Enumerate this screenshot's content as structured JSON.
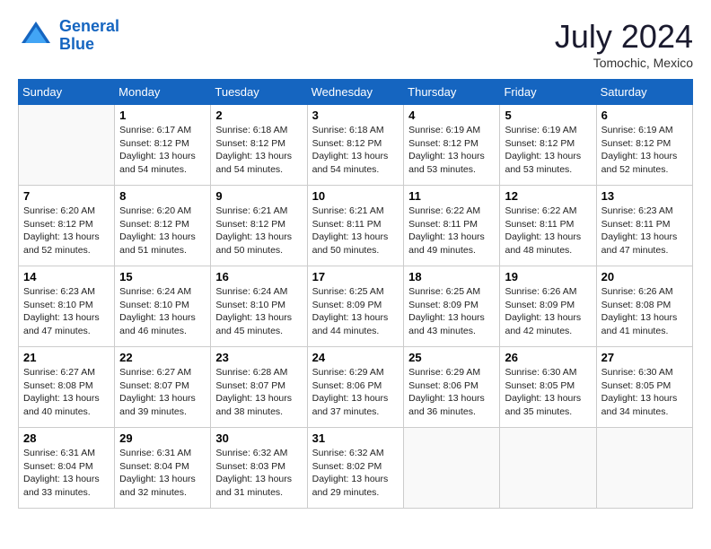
{
  "header": {
    "logo_line1": "General",
    "logo_line2": "Blue",
    "month": "July 2024",
    "location": "Tomochic, Mexico"
  },
  "weekdays": [
    "Sunday",
    "Monday",
    "Tuesday",
    "Wednesday",
    "Thursday",
    "Friday",
    "Saturday"
  ],
  "weeks": [
    [
      {
        "day": "",
        "sunrise": "",
        "sunset": "",
        "daylight": ""
      },
      {
        "day": "1",
        "sunrise": "Sunrise: 6:17 AM",
        "sunset": "Sunset: 8:12 PM",
        "daylight": "Daylight: 13 hours and 54 minutes."
      },
      {
        "day": "2",
        "sunrise": "Sunrise: 6:18 AM",
        "sunset": "Sunset: 8:12 PM",
        "daylight": "Daylight: 13 hours and 54 minutes."
      },
      {
        "day": "3",
        "sunrise": "Sunrise: 6:18 AM",
        "sunset": "Sunset: 8:12 PM",
        "daylight": "Daylight: 13 hours and 54 minutes."
      },
      {
        "day": "4",
        "sunrise": "Sunrise: 6:19 AM",
        "sunset": "Sunset: 8:12 PM",
        "daylight": "Daylight: 13 hours and 53 minutes."
      },
      {
        "day": "5",
        "sunrise": "Sunrise: 6:19 AM",
        "sunset": "Sunset: 8:12 PM",
        "daylight": "Daylight: 13 hours and 53 minutes."
      },
      {
        "day": "6",
        "sunrise": "Sunrise: 6:19 AM",
        "sunset": "Sunset: 8:12 PM",
        "daylight": "Daylight: 13 hours and 52 minutes."
      }
    ],
    [
      {
        "day": "7",
        "sunrise": "Sunrise: 6:20 AM",
        "sunset": "Sunset: 8:12 PM",
        "daylight": "Daylight: 13 hours and 52 minutes."
      },
      {
        "day": "8",
        "sunrise": "Sunrise: 6:20 AM",
        "sunset": "Sunset: 8:12 PM",
        "daylight": "Daylight: 13 hours and 51 minutes."
      },
      {
        "day": "9",
        "sunrise": "Sunrise: 6:21 AM",
        "sunset": "Sunset: 8:12 PM",
        "daylight": "Daylight: 13 hours and 50 minutes."
      },
      {
        "day": "10",
        "sunrise": "Sunrise: 6:21 AM",
        "sunset": "Sunset: 8:11 PM",
        "daylight": "Daylight: 13 hours and 50 minutes."
      },
      {
        "day": "11",
        "sunrise": "Sunrise: 6:22 AM",
        "sunset": "Sunset: 8:11 PM",
        "daylight": "Daylight: 13 hours and 49 minutes."
      },
      {
        "day": "12",
        "sunrise": "Sunrise: 6:22 AM",
        "sunset": "Sunset: 8:11 PM",
        "daylight": "Daylight: 13 hours and 48 minutes."
      },
      {
        "day": "13",
        "sunrise": "Sunrise: 6:23 AM",
        "sunset": "Sunset: 8:11 PM",
        "daylight": "Daylight: 13 hours and 47 minutes."
      }
    ],
    [
      {
        "day": "14",
        "sunrise": "Sunrise: 6:23 AM",
        "sunset": "Sunset: 8:10 PM",
        "daylight": "Daylight: 13 hours and 47 minutes."
      },
      {
        "day": "15",
        "sunrise": "Sunrise: 6:24 AM",
        "sunset": "Sunset: 8:10 PM",
        "daylight": "Daylight: 13 hours and 46 minutes."
      },
      {
        "day": "16",
        "sunrise": "Sunrise: 6:24 AM",
        "sunset": "Sunset: 8:10 PM",
        "daylight": "Daylight: 13 hours and 45 minutes."
      },
      {
        "day": "17",
        "sunrise": "Sunrise: 6:25 AM",
        "sunset": "Sunset: 8:09 PM",
        "daylight": "Daylight: 13 hours and 44 minutes."
      },
      {
        "day": "18",
        "sunrise": "Sunrise: 6:25 AM",
        "sunset": "Sunset: 8:09 PM",
        "daylight": "Daylight: 13 hours and 43 minutes."
      },
      {
        "day": "19",
        "sunrise": "Sunrise: 6:26 AM",
        "sunset": "Sunset: 8:09 PM",
        "daylight": "Daylight: 13 hours and 42 minutes."
      },
      {
        "day": "20",
        "sunrise": "Sunrise: 6:26 AM",
        "sunset": "Sunset: 8:08 PM",
        "daylight": "Daylight: 13 hours and 41 minutes."
      }
    ],
    [
      {
        "day": "21",
        "sunrise": "Sunrise: 6:27 AM",
        "sunset": "Sunset: 8:08 PM",
        "daylight": "Daylight: 13 hours and 40 minutes."
      },
      {
        "day": "22",
        "sunrise": "Sunrise: 6:27 AM",
        "sunset": "Sunset: 8:07 PM",
        "daylight": "Daylight: 13 hours and 39 minutes."
      },
      {
        "day": "23",
        "sunrise": "Sunrise: 6:28 AM",
        "sunset": "Sunset: 8:07 PM",
        "daylight": "Daylight: 13 hours and 38 minutes."
      },
      {
        "day": "24",
        "sunrise": "Sunrise: 6:29 AM",
        "sunset": "Sunset: 8:06 PM",
        "daylight": "Daylight: 13 hours and 37 minutes."
      },
      {
        "day": "25",
        "sunrise": "Sunrise: 6:29 AM",
        "sunset": "Sunset: 8:06 PM",
        "daylight": "Daylight: 13 hours and 36 minutes."
      },
      {
        "day": "26",
        "sunrise": "Sunrise: 6:30 AM",
        "sunset": "Sunset: 8:05 PM",
        "daylight": "Daylight: 13 hours and 35 minutes."
      },
      {
        "day": "27",
        "sunrise": "Sunrise: 6:30 AM",
        "sunset": "Sunset: 8:05 PM",
        "daylight": "Daylight: 13 hours and 34 minutes."
      }
    ],
    [
      {
        "day": "28",
        "sunrise": "Sunrise: 6:31 AM",
        "sunset": "Sunset: 8:04 PM",
        "daylight": "Daylight: 13 hours and 33 minutes."
      },
      {
        "day": "29",
        "sunrise": "Sunrise: 6:31 AM",
        "sunset": "Sunset: 8:04 PM",
        "daylight": "Daylight: 13 hours and 32 minutes."
      },
      {
        "day": "30",
        "sunrise": "Sunrise: 6:32 AM",
        "sunset": "Sunset: 8:03 PM",
        "daylight": "Daylight: 13 hours and 31 minutes."
      },
      {
        "day": "31",
        "sunrise": "Sunrise: 6:32 AM",
        "sunset": "Sunset: 8:02 PM",
        "daylight": "Daylight: 13 hours and 29 minutes."
      },
      {
        "day": "",
        "sunrise": "",
        "sunset": "",
        "daylight": ""
      },
      {
        "day": "",
        "sunrise": "",
        "sunset": "",
        "daylight": ""
      },
      {
        "day": "",
        "sunrise": "",
        "sunset": "",
        "daylight": ""
      }
    ]
  ]
}
